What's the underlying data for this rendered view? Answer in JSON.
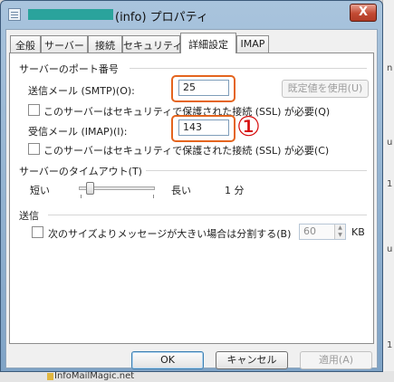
{
  "window": {
    "title": "(info) プロパティ",
    "close_glyph": "X"
  },
  "tabs": [
    {
      "label": "全般"
    },
    {
      "label": "サーバー"
    },
    {
      "label": "接続"
    },
    {
      "label": "セキュリティ"
    },
    {
      "label": "詳細設定",
      "active": true
    },
    {
      "label": "IMAP"
    }
  ],
  "server_ports": {
    "heading": "サーバーのポート番号",
    "smtp_label": "送信メール (SMTP)(O):",
    "smtp_value": "25",
    "default_button": "既定値を使用(U)",
    "smtp_ssl_label": "このサーバーはセキュリティで保護された接続 (SSL) が必要(Q)",
    "smtp_ssl_checked": false,
    "imap_label": "受信メール (IMAP)(I):",
    "imap_value": "143",
    "imap_ssl_label": "このサーバーはセキュリティで保護された接続 (SSL) が必要(C)",
    "imap_ssl_checked": false
  },
  "annotation": {
    "marker": "①",
    "color": "#d60d0d",
    "highlight_color": "#e4641e"
  },
  "timeout": {
    "heading": "サーバーのタイムアウト(T)",
    "short_label": "短い",
    "long_label": "長い",
    "value_text": "1 分",
    "slider_level": 0.1
  },
  "sending": {
    "heading": "送信",
    "split_label": "次のサイズよりメッセージが大きい場合は分割する(B)",
    "split_checked": false,
    "size_value": "60",
    "size_unit": "KB"
  },
  "buttons": {
    "ok": "OK",
    "cancel": "キャンセル",
    "apply": "適用(A)"
  },
  "background_right_marks": [
    "n",
    "u",
    "1",
    "u",
    "1"
  ],
  "background_bottom_text": "InfoMailMagic.net",
  "colors": {
    "title_gradient_top": "#a9c4dd",
    "redaction": "#2aa39c"
  }
}
